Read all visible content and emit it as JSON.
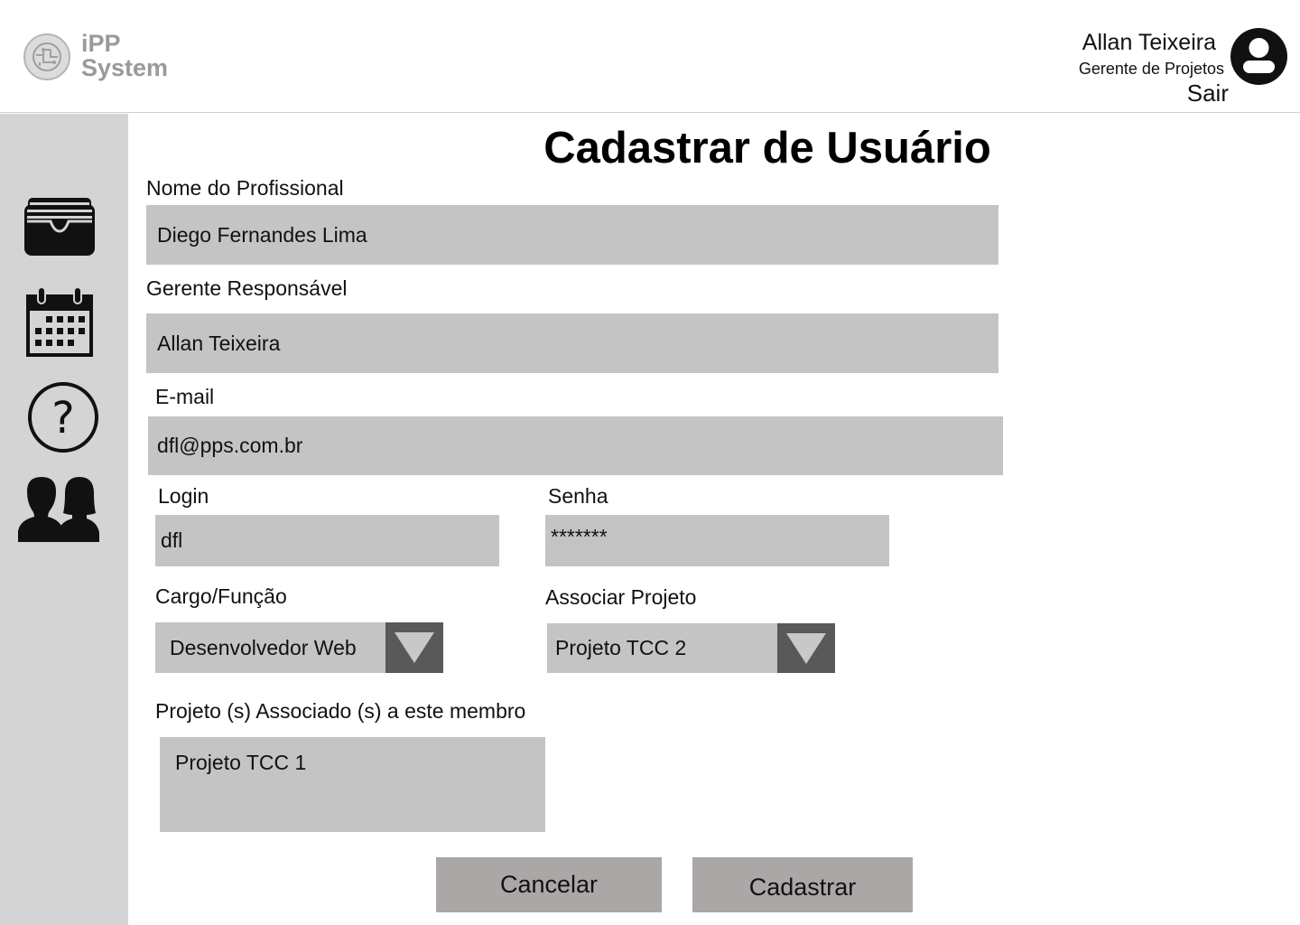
{
  "app": {
    "logo_line1": "iPP",
    "logo_line2": "System"
  },
  "user": {
    "name": "Allan Teixeira",
    "role": "Gerente de Projetos",
    "logout_label": "Sair"
  },
  "sidebar": {
    "items": [
      {
        "icon": "wallet-icon"
      },
      {
        "icon": "calendar-icon"
      },
      {
        "icon": "help-icon"
      },
      {
        "icon": "users-icon"
      }
    ]
  },
  "form": {
    "title": "Cadastrar de Usuário",
    "name_label": "Nome do  Profissional",
    "name_value": "Diego Fernandes Lima",
    "manager_label": "Gerente Responsável",
    "manager_value": "Allan Teixeira",
    "email_label": "E-mail",
    "email_value": "dfl@pps.com.br",
    "login_label": "Login",
    "login_value": "dfl",
    "password_label": "Senha",
    "password_value": "*******",
    "role_label": "Cargo/Função",
    "role_value": "Desenvolvedor Web",
    "project_label": "Associar Projeto",
    "project_value": "Projeto TCC 2",
    "assoc_label": "Projeto (s) Associado (s) a este membro",
    "assoc_items": [
      "Projeto TCC 1"
    ],
    "cancel_label": "Cancelar",
    "submit_label": "Cadastrar"
  }
}
